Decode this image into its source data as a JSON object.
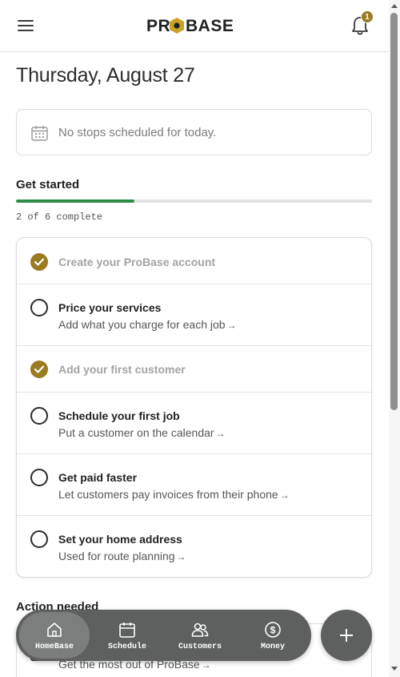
{
  "header": {
    "logo_text": "PROBASE",
    "notification_count": "1"
  },
  "date_title": "Thursday, August 27",
  "schedule": {
    "empty_text": "No stops scheduled for today."
  },
  "get_started": {
    "title": "Get started",
    "progress_text": "2 of 6 complete",
    "progress_fraction": 0.333,
    "tasks": [
      {
        "title": "Create your ProBase account",
        "subtitle": "",
        "done": true
      },
      {
        "title": "Price your services",
        "subtitle": "Add what you charge for each job",
        "done": false
      },
      {
        "title": "Add your first customer",
        "subtitle": "",
        "done": true
      },
      {
        "title": "Schedule your first job",
        "subtitle": "Put a customer on the calendar",
        "done": false
      },
      {
        "title": "Get paid faster",
        "subtitle": "Let customers pay invoices from their phone",
        "done": false
      },
      {
        "title": "Set your home address",
        "subtitle": "Used for route planning",
        "done": false
      }
    ],
    "arrow": "→"
  },
  "action_needed": {
    "title": "Action needed",
    "item_subtitle": "Get the most out of ProBase"
  },
  "nav": {
    "items": [
      {
        "label": "HomeBase",
        "icon": "home-icon",
        "active": true
      },
      {
        "label": "Schedule",
        "icon": "calendar-icon",
        "active": false
      },
      {
        "label": "Customers",
        "icon": "users-icon",
        "active": false
      },
      {
        "label": "Money",
        "icon": "dollar-icon",
        "active": false
      }
    ]
  },
  "colors": {
    "accent": "#9a7b22",
    "progress": "#2e8b4a",
    "nav_bg": "#5e6060"
  }
}
